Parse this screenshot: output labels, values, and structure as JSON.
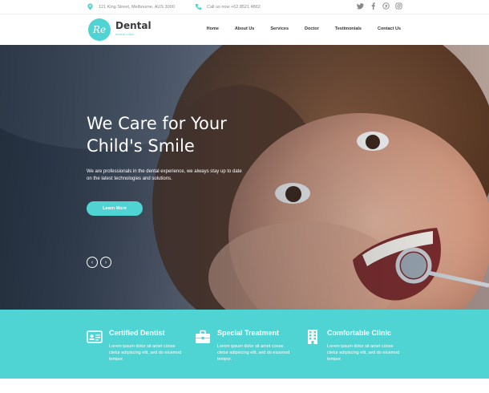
{
  "topbar": {
    "address": "121 King Street, Melbourne, AUS 3000",
    "phone": "Call us now +62 8521 4862",
    "social_icons": [
      "twitter-icon",
      "facebook-icon",
      "pinterest-icon",
      "instagram-icon"
    ]
  },
  "header": {
    "logo_mark": "Re",
    "logo_title": "Dental",
    "logo_subtitle": "dental clinic",
    "nav": [
      "Home",
      "About Us",
      "Services",
      "Doctor",
      "Testimonials",
      "Contact Us"
    ]
  },
  "hero": {
    "title_line1": "We Care for Your",
    "title_line2": "Child's Smile",
    "text": "We are professionals in the dental experience, we always stay up to date on the latest technologies and solutions.",
    "button_label": "Learn More",
    "prev_label": "‹",
    "next_label": "›"
  },
  "features": [
    {
      "title": "Certified Dentist",
      "text": "Lorem ipsum dolor sit amet conse ctetur adipiscing elit, sed do eiusmod tempor.",
      "icon": "id-card-icon"
    },
    {
      "title": "Special Treatment",
      "text": "Lorem ipsum dolor sit amet conse ctetur adipiscing elit, sed do eiusmod tempor.",
      "icon": "briefcase-icon"
    },
    {
      "title": "Comfortable Clinic",
      "text": "Lorem ipsum dolor sit amet conse ctetur adipiscing elit, sed do eiusmod tempor.",
      "icon": "building-icon"
    }
  ],
  "colors": {
    "accent": "#4fd3d3",
    "text_dark": "#333333"
  }
}
